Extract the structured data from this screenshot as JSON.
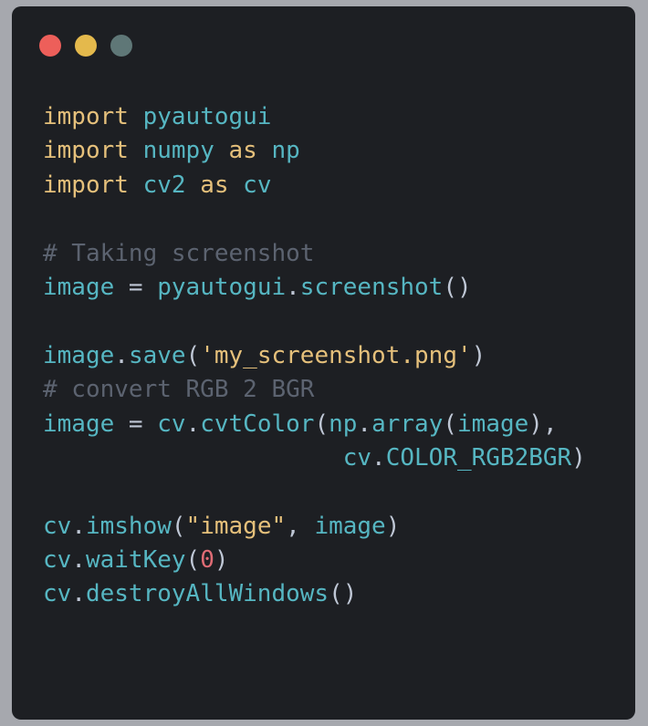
{
  "window": {
    "controls": {
      "close_color": "#ed5f5a",
      "minimize_color": "#e4b94c",
      "maximize_color": "#5f7777"
    }
  },
  "code": {
    "language": "python",
    "lines": [
      [
        {
          "t": "import",
          "c": "kw"
        },
        {
          "t": " ",
          "c": "ws"
        },
        {
          "t": "pyautogui",
          "c": "id"
        }
      ],
      [
        {
          "t": "import",
          "c": "kw"
        },
        {
          "t": " ",
          "c": "ws"
        },
        {
          "t": "numpy",
          "c": "id"
        },
        {
          "t": " ",
          "c": "ws"
        },
        {
          "t": "as",
          "c": "kw"
        },
        {
          "t": " ",
          "c": "ws"
        },
        {
          "t": "np",
          "c": "id"
        }
      ],
      [
        {
          "t": "import",
          "c": "kw"
        },
        {
          "t": " ",
          "c": "ws"
        },
        {
          "t": "cv2",
          "c": "id"
        },
        {
          "t": " ",
          "c": "ws"
        },
        {
          "t": "as",
          "c": "kw"
        },
        {
          "t": " ",
          "c": "ws"
        },
        {
          "t": "cv",
          "c": "id"
        }
      ],
      [],
      [
        {
          "t": "# Taking screenshot",
          "c": "cmt"
        }
      ],
      [
        {
          "t": "image",
          "c": "id"
        },
        {
          "t": " = ",
          "c": "op"
        },
        {
          "t": "pyautogui",
          "c": "id"
        },
        {
          "t": ".",
          "c": "op"
        },
        {
          "t": "screenshot",
          "c": "id"
        },
        {
          "t": "()",
          "c": "op"
        }
      ],
      [],
      [
        {
          "t": "image",
          "c": "id"
        },
        {
          "t": ".",
          "c": "op"
        },
        {
          "t": "save",
          "c": "id"
        },
        {
          "t": "(",
          "c": "op"
        },
        {
          "t": "'my_screenshot.png'",
          "c": "str"
        },
        {
          "t": ")",
          "c": "op"
        }
      ],
      [
        {
          "t": "# convert RGB 2 BGR",
          "c": "cmt"
        }
      ],
      [
        {
          "t": "image",
          "c": "id"
        },
        {
          "t": " = ",
          "c": "op"
        },
        {
          "t": "cv",
          "c": "id"
        },
        {
          "t": ".",
          "c": "op"
        },
        {
          "t": "cvtColor",
          "c": "id"
        },
        {
          "t": "(",
          "c": "op"
        },
        {
          "t": "np",
          "c": "id"
        },
        {
          "t": ".",
          "c": "op"
        },
        {
          "t": "array",
          "c": "id"
        },
        {
          "t": "(",
          "c": "op"
        },
        {
          "t": "image",
          "c": "id"
        },
        {
          "t": "),",
          "c": "op"
        }
      ],
      [
        {
          "t": "                     ",
          "c": "ws"
        },
        {
          "t": "cv",
          "c": "id"
        },
        {
          "t": ".",
          "c": "op"
        },
        {
          "t": "COLOR_RGB2BGR",
          "c": "id"
        },
        {
          "t": ")",
          "c": "op"
        }
      ],
      [],
      [
        {
          "t": "cv",
          "c": "id"
        },
        {
          "t": ".",
          "c": "op"
        },
        {
          "t": "imshow",
          "c": "id"
        },
        {
          "t": "(",
          "c": "op"
        },
        {
          "t": "\"image\"",
          "c": "str"
        },
        {
          "t": ", ",
          "c": "op"
        },
        {
          "t": "image",
          "c": "id"
        },
        {
          "t": ")",
          "c": "op"
        }
      ],
      [
        {
          "t": "cv",
          "c": "id"
        },
        {
          "t": ".",
          "c": "op"
        },
        {
          "t": "waitKey",
          "c": "id"
        },
        {
          "t": "(",
          "c": "op"
        },
        {
          "t": "0",
          "c": "num"
        },
        {
          "t": ")",
          "c": "op"
        }
      ],
      [
        {
          "t": "cv",
          "c": "id"
        },
        {
          "t": ".",
          "c": "op"
        },
        {
          "t": "destroyAllWindows",
          "c": "id"
        },
        {
          "t": "()",
          "c": "op"
        }
      ]
    ]
  }
}
